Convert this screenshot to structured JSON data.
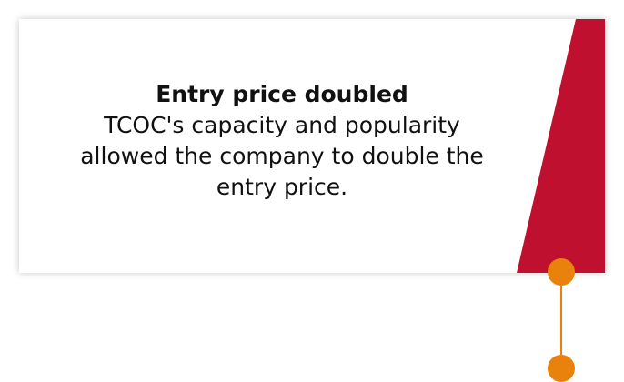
{
  "card": {
    "title": "Entry price doubled",
    "body_lines": [
      "TCOC's capacity and popularity",
      "allowed the company to double the",
      "entry price."
    ]
  },
  "colors": {
    "accent_stripe": "#c0102f",
    "marker": "#e8820c",
    "text": "#111111"
  }
}
